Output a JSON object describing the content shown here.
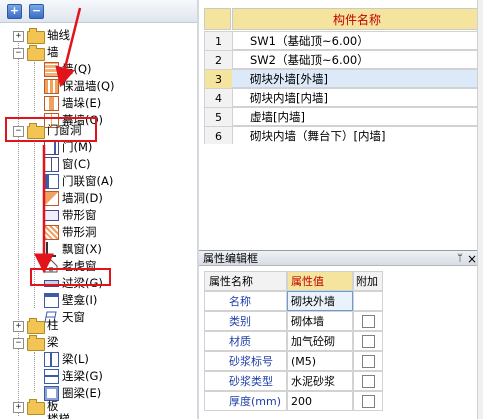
{
  "toolbar": {
    "add_label": "+",
    "remove_label": "−"
  },
  "tree": {
    "axis": "轴线",
    "wall": "墙",
    "wall_children": [
      "墙(Q)",
      "保温墙(Q)",
      "墙垛(E)",
      "幕墙(Q)"
    ],
    "openings": "门窗洞",
    "openings_children": [
      "门(M)",
      "窗(C)",
      "门联窗(A)",
      "墙洞(D)",
      "带形窗",
      "带形洞",
      "飘窗(X)",
      "老虎窗",
      "过梁(G)",
      "壁龛(I)",
      "天窗"
    ],
    "column": "柱",
    "beam": "梁",
    "beam_children": [
      "梁(L)",
      "连梁(G)",
      "圈梁(E)"
    ],
    "slab": "板",
    "stair": "楼梯"
  },
  "component_table": {
    "header": "构件名称",
    "rows": [
      {
        "num": "1",
        "name": "SW1（基础顶~6.00）"
      },
      {
        "num": "2",
        "name": "SW2（基础顶~6.00）"
      },
      {
        "num": "3",
        "name": "砌块外墙[外墙]"
      },
      {
        "num": "4",
        "name": "砌块内墙[内墙]"
      },
      {
        "num": "5",
        "name": "虚墙[内墙]"
      },
      {
        "num": "6",
        "name": "砌块内墙（舞台下）[内墙]"
      }
    ],
    "selected_row": 3
  },
  "property_panel": {
    "title": "属性编辑框",
    "pin_icon": "pin-icon",
    "close_label": "×",
    "headers": [
      "属性名称",
      "属性值",
      "附加"
    ],
    "rows": [
      {
        "name": "名称",
        "value": "砌块外墙",
        "has_checkbox": false
      },
      {
        "name": "类别",
        "value": "砌体墙",
        "has_checkbox": true
      },
      {
        "name": "材质",
        "value": "加气砼砌",
        "has_checkbox": true
      },
      {
        "name": "砂浆标号",
        "value": "(M5)",
        "has_checkbox": true
      },
      {
        "name": "砂浆类型",
        "value": "水泥砂浆",
        "has_checkbox": true
      },
      {
        "name": "厚度(mm)",
        "value": "200",
        "has_checkbox": true
      }
    ]
  },
  "colors": {
    "highlight_red": "#e0141a",
    "header_yellow": "#f4e49d",
    "header_text": "#c00000",
    "selected_row": "#dce9f8",
    "property_label_blue": "#1f3ea8"
  }
}
